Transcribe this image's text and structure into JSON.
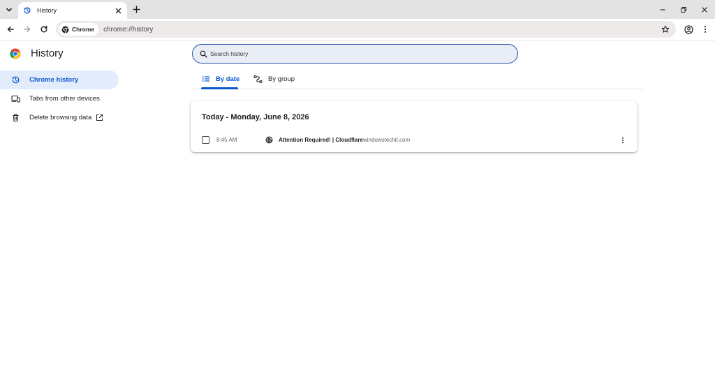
{
  "browser": {
    "tab": {
      "title": "History"
    },
    "omnibox": {
      "site_chip": "Chrome",
      "url": "chrome://history"
    }
  },
  "sidebar": {
    "title": "History",
    "items": [
      {
        "label": "Chrome history",
        "icon": "history-icon",
        "active": true
      },
      {
        "label": "Tabs from other devices",
        "icon": "devices-icon",
        "active": false
      },
      {
        "label": "Delete browsing data",
        "icon": "trash-icon",
        "active": false
      }
    ]
  },
  "search": {
    "placeholder": "Search history",
    "value": ""
  },
  "view_tabs": [
    {
      "label": "By date",
      "icon": "list-icon",
      "active": true
    },
    {
      "label": "By group",
      "icon": "group-icon",
      "active": false
    }
  ],
  "history": {
    "day_heading": "Today - Monday, June 8, 2026",
    "entries": [
      {
        "time": "8:45 AM",
        "title": "Attention Required! | Cloudflare",
        "domain": "windowstechit.com"
      }
    ]
  },
  "colors": {
    "accent": "#0b57d0",
    "active_bg": "#e3ecfb",
    "search_border": "#1d4fa3"
  }
}
